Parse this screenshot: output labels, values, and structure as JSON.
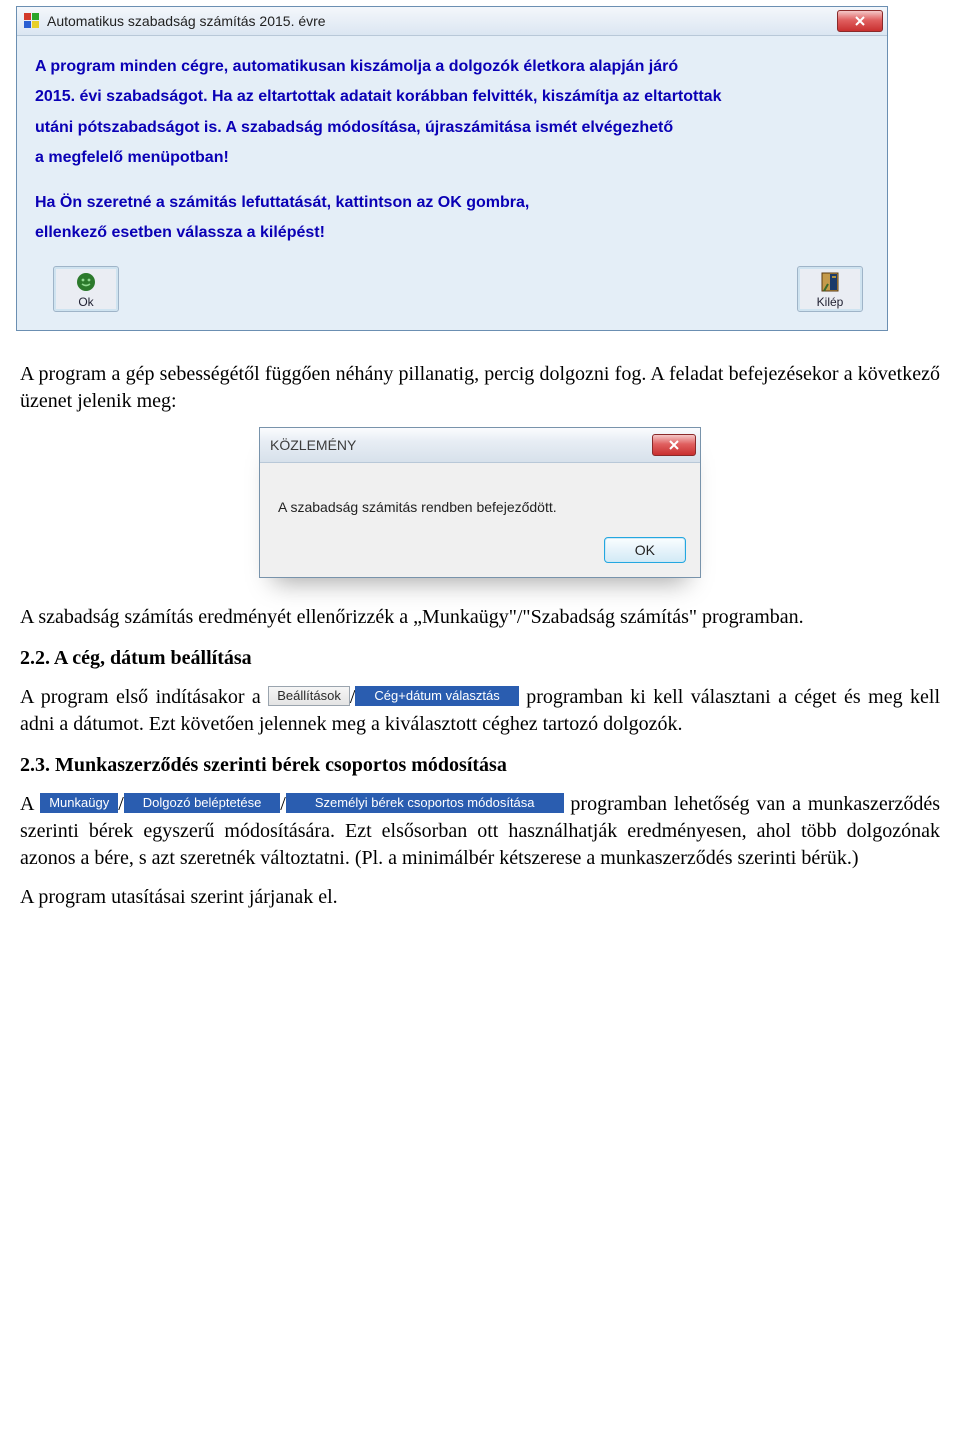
{
  "dialog1": {
    "title": "Automatikus szabadság számítás 2015. évre",
    "lines": [
      "A program minden cégre, automatikusan kiszámolja a dolgozók életkora alapján járó",
      "2015. évi szabadságot. Ha az eltartottak adatait korábban felvitték,  kiszámítja az eltartottak",
      "utáni pótszabadságot is. A szabadság módosítása, újraszámitása ismét elvégezhető",
      "a megfelelő menüpotban!",
      "",
      "Ha Ön szeretné a számitás lefuttatását, kattintson az OK gombra,",
      "ellenkező esetben válassza a kilépést!"
    ],
    "ok_label": "Ok",
    "exit_label": "Kilép"
  },
  "para1": "A program a gép sebességétől függően néhány pillanatig, percig dolgozni fog. A feladat befejezésekor a következő üzenet jelenik meg:",
  "dialog2": {
    "title": "KÖZLEMÉNY",
    "body": "A szabadság számitás rendben befejeződött.",
    "ok_label": "OK"
  },
  "para2": "A szabadság számítás eredményét ellenőrizzék a „Munkaügy\"/\"Szabadság számítás\" programban.",
  "section22": {
    "heading": "2.2. A cég, dátum beállítása",
    "text_before": "A program első indításakor a ",
    "menu1": "Beállítások",
    "slash": "/",
    "menu2": "Cég+dátum választás",
    "text_after": " programban ki kell választani a céget és meg kell adni a dátumot. Ezt követően jelennek meg a kiválasztott céghez tartozó dolgozók."
  },
  "section23": {
    "heading": "2.3. Munkaszerződés szerinti bérek csoportos módosítása",
    "text_a": "A ",
    "menu1": "Munkaügy",
    "slash1": "/",
    "menu2": "Dolgozó beléptetése",
    "slash2": "/",
    "menu3": "Személyi bérek csoportos módosítása",
    "text_after": " programban lehetőség van a munkaszerződés szerinti bérek egyszerű módosítására. Ezt elsősorban ott használhatják eredményesen, ahol több dolgozónak azonos a bére, s azt szeretnék változtatni. (Pl. a minimálbér kétszerese a munkaszerződés szerinti bérük.)"
  },
  "para_last": "A program utasításai szerint járjanak el."
}
